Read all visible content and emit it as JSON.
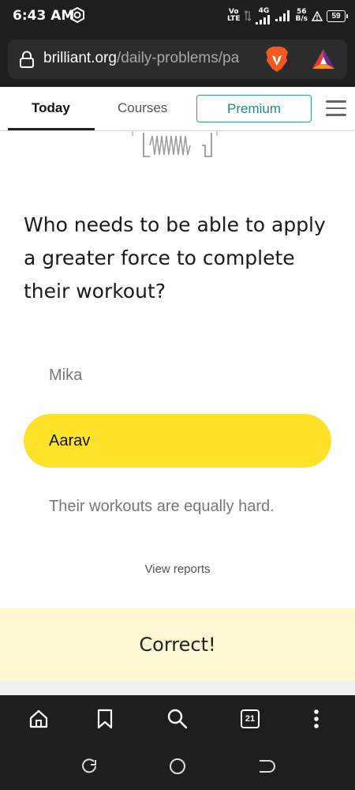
{
  "status_bar": {
    "time": "6:43 AM",
    "volte_top": "Vo",
    "volte_bottom": "LTE",
    "network_type": "4G",
    "speed_value": "56",
    "speed_unit": "B/s",
    "battery": "59"
  },
  "browser": {
    "url_domain": "brilliant.org",
    "url_path": "/daily-problems/pa",
    "tabs_count": "21"
  },
  "site_nav": {
    "tabs": [
      {
        "label": "Today"
      },
      {
        "label": "Courses"
      }
    ],
    "premium_label": "Premium"
  },
  "problem": {
    "question": "Who needs to be able to apply a greater force to complete their workout?",
    "choices": [
      {
        "label": "Mika"
      },
      {
        "label": "Aarav"
      },
      {
        "label": "Their workouts are equally hard."
      }
    ],
    "selected_choice": "Aarav",
    "view_reports": "View reports",
    "result": "Correct!"
  },
  "colors": {
    "selected_choice_bg": "#fde22a",
    "result_banner_bg": "#fdf8d3",
    "premium_accent": "#2a9d8f",
    "chrome_dark": "#1e1e1e"
  },
  "icons": [
    "lock-icon",
    "brave-lion-icon",
    "bat-rewards-icon",
    "menu-icon",
    "home-icon",
    "bookmark-icon",
    "search-icon",
    "tabs-icon",
    "more-icon",
    "recent-apps-icon",
    "home-circle-icon",
    "back-icon"
  ]
}
